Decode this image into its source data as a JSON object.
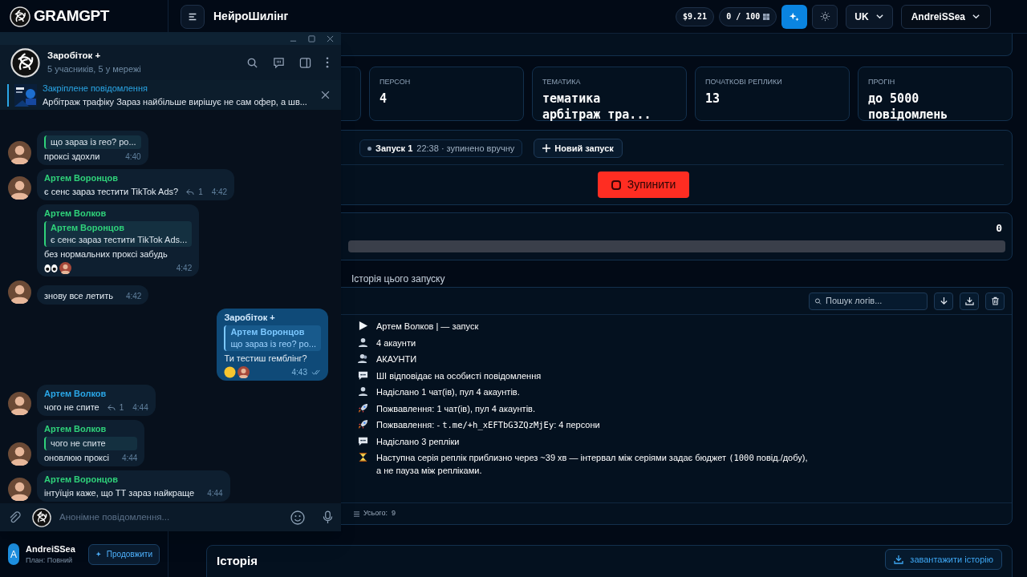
{
  "app": {
    "logo": "GRAMGPT",
    "title": "НейроШилінг"
  },
  "topbar": {
    "balance": "$9.21",
    "quota": "0 / 100",
    "language": "UK",
    "user": "AndreiSSea"
  },
  "sidebar_user": {
    "initial": "A",
    "name": "AndreiSSea",
    "plan": "План: Повний",
    "button": "Продовжити"
  },
  "stats": [
    {
      "label": "ПЕРСОН",
      "value": "4"
    },
    {
      "label": "ТЕМАТИКА",
      "value": "тематика арбітраж тра..."
    },
    {
      "label": "ПОЧАТКОВІ РЕПЛИКИ",
      "value": "13"
    },
    {
      "label": "ПРОГІН",
      "value": "до 5000 повідомлень"
    }
  ],
  "run": {
    "chip_name": "Запуск 1",
    "chip_detail": "22:38 · зупинено вручну",
    "new_button": "Новий запуск",
    "stop_button": "Зупинити"
  },
  "progress": {
    "count": "0",
    "level": 0
  },
  "history_label": "Історія цього запуску",
  "logs": {
    "search_placeholder": "Пошук логів...",
    "total": "Усього:  9",
    "lines": [
      {
        "kind": "play",
        "parts": [
          {
            "text": "Артем Волков | — запуск"
          }
        ]
      },
      {
        "kind": "user",
        "parts": [
          {
            "text": "4 акаунти"
          }
        ]
      },
      {
        "kind": "users",
        "parts": [
          {
            "text": "АКАУНТИ"
          }
        ]
      },
      {
        "kind": "chat",
        "parts": [
          {
            "text": "ШІ відповідає на особисті повідомлення"
          }
        ]
      },
      {
        "kind": "user",
        "parts": [
          {
            "text": "Надіслано 1 чат(ів), пул 4 акаунтів."
          }
        ]
      },
      {
        "kind": "rocket",
        "parts": [
          {
            "text": "Пожвавлення: 1 чат(ів), пул 4 акаунтів."
          }
        ]
      },
      {
        "kind": "rocket",
        "parts": [
          {
            "text": "Пожвавлення: - "
          },
          {
            "text": "t.me/+h_xEFTbG3ZQzMjEy",
            "mono": true
          },
          {
            "text": ": 4 персони"
          }
        ]
      },
      {
        "kind": "chat",
        "parts": [
          {
            "text": "Надіслано 3 репліки"
          }
        ]
      },
      {
        "kind": "hourglass",
        "parts": [
          {
            "text": "Наступна серія реплік приблизно через ~39 хв — інтервал між серіями задає бюджет "
          },
          {
            "text": "(1000",
            "mono": true
          },
          {
            "text": " повід./добу),\nа не пауза між репліками."
          }
        ]
      }
    ]
  },
  "history": {
    "title": "Історія",
    "download_button": "завантажити історію"
  },
  "chat": {
    "title": "Заробіток +",
    "subtitle": "5 учасників, 5 у мережі",
    "pinned": {
      "title": "Закріплене повідомлення",
      "text": "Арбітраж трафіку Зараз найбільше вирішує не сам офер, а шв..."
    },
    "input_placeholder": "Анонімне повідомлення...",
    "messages": [
      {
        "kind": "incoming",
        "avatar": true,
        "quote": {
          "text": "що зараз із гео? ро..."
        },
        "text": "проксі здохли",
        "time": "4:40"
      },
      {
        "kind": "incoming",
        "avatar": true,
        "sender": "Артем Воронцов",
        "color": "#2fd27a",
        "text": "є сенс зараз тестити TikTok Ads?",
        "replies": "1",
        "time": "4:42"
      },
      {
        "kind": "incoming",
        "avatar": false,
        "sender": "Артем Волков",
        "color": "#2fd27a",
        "quote": {
          "sender": "Артем Воронцов",
          "color": "#2fd27a",
          "text": "є сенс зараз тестити TikTok Ads..."
        },
        "text": "без нормальних проксі забудь",
        "reactions": [
          {
            "kind": "eyes"
          },
          {
            "kind": "avatar"
          }
        ],
        "time": "4:42"
      },
      {
        "kind": "incoming",
        "avatar": true,
        "text": "знову все летить",
        "time": "4:42"
      },
      {
        "kind": "outgoing",
        "sender": "Заробіток +",
        "color": "#d7ecff",
        "quote": {
          "sender": "Артем Воронцов",
          "color": "#7cc8ff",
          "text": "що зараз із гео? ро..."
        },
        "text": "Ти тестиш гемблінг?",
        "reactions": [
          {
            "kind": "thinking"
          },
          {
            "kind": "avatar"
          }
        ],
        "time": "4:43",
        "read": true
      },
      {
        "kind": "incoming",
        "avatar": true,
        "sender": "Артем Волков",
        "color": "#2aa7e8",
        "text": "чого не спите",
        "replies": "1",
        "time": "4:44"
      },
      {
        "kind": "incoming",
        "avatar": true,
        "sender": "Артем Волков",
        "color": "#2fd27a",
        "quote": {
          "text": "чого не спите"
        },
        "text": "оновлюю проксі",
        "time": "4:44"
      },
      {
        "kind": "incoming",
        "avatar": true,
        "sender": "Артем Воронцов",
        "color": "#2fd27a",
        "text": "інтуїція каже, що ТТ зараз найкраще",
        "time": "4:44"
      }
    ]
  }
}
